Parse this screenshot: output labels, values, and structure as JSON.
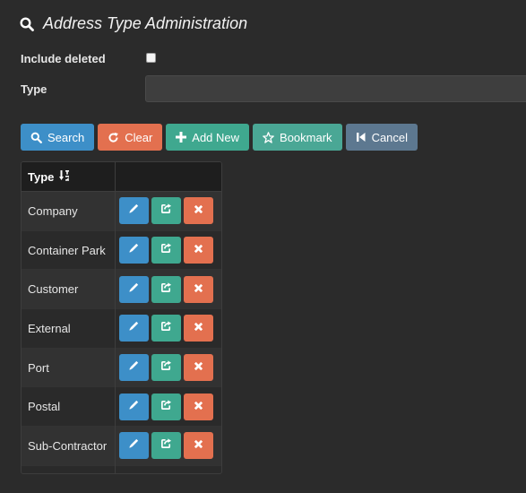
{
  "page": {
    "title": "Address Type Administration",
    "title_icon": "search-icon"
  },
  "form": {
    "include_deleted_label": "Include deleted",
    "include_deleted_checked": false,
    "type_label": "Type",
    "type_value": ""
  },
  "toolbar": {
    "search_label": "Search",
    "clear_label": "Clear",
    "add_new_label": "Add New",
    "bookmark_label": "Bookmark",
    "cancel_label": "Cancel"
  },
  "grid": {
    "column_header": "Type",
    "sort_icon": "sort-alpha-icon",
    "rows": [
      {
        "type": "Company"
      },
      {
        "type": "Container Park"
      },
      {
        "type": "Customer"
      },
      {
        "type": "External"
      },
      {
        "type": "Port"
      },
      {
        "type": "Postal"
      },
      {
        "type": "Sub-Contractor"
      }
    ]
  },
  "colors": {
    "background": "#2b2b2b",
    "primary_blue": "#3d8fc8",
    "danger_orange": "#e3704f",
    "success_teal": "#3fa88f",
    "slate": "#5d7890"
  }
}
